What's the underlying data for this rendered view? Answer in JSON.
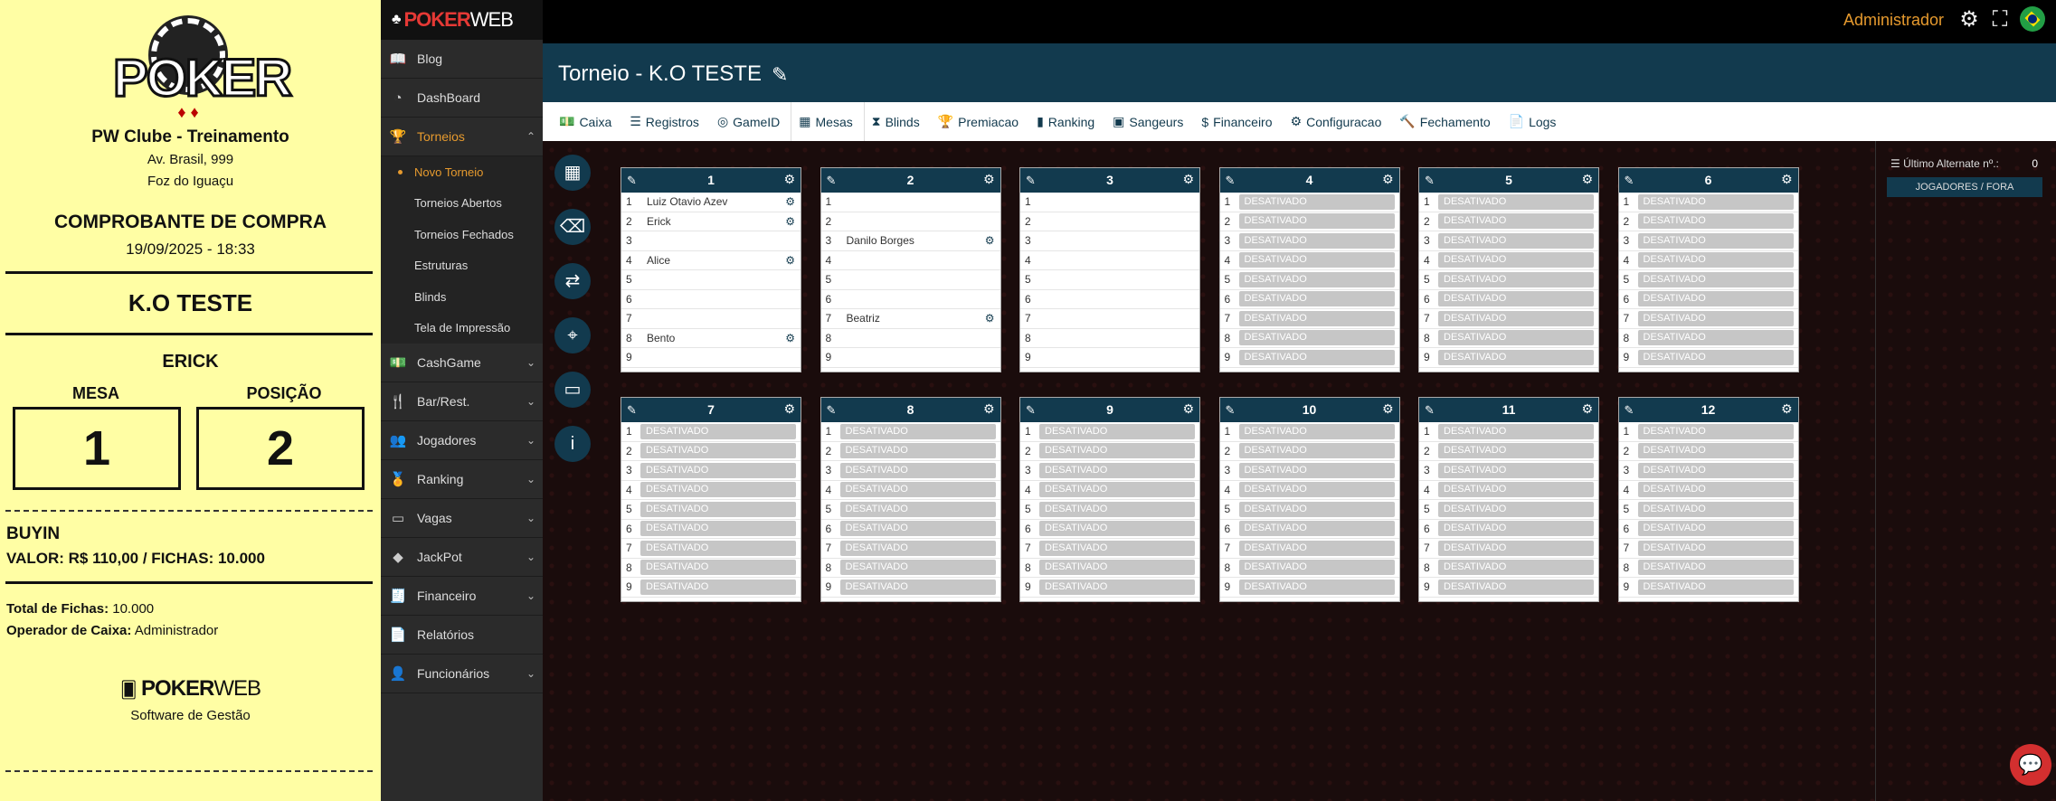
{
  "receipt": {
    "logo_text": "POKER",
    "club": "PW Clube - Treinamento",
    "address": "Av. Brasil, 999",
    "city": "Foz do Iguaçu",
    "title": "COMPROBANTE DE COMPRA",
    "datetime": "19/09/2025 - 18:33",
    "tournament": "K.O TESTE",
    "player": "ERICK",
    "mesa_label": "MESA",
    "posicao_label": "POSIÇÃO",
    "mesa": "1",
    "posicao": "2",
    "buyin_label": "BUYIN",
    "valor_line": "VALOR: R$ 110,00 / FICHAS: 10.000",
    "total_label": "Total de Fichas:",
    "total_value": " 10.000",
    "operador_label": "Operador de Caixa:",
    "operador_value": " Administrador",
    "footer_brand_a": "POKER",
    "footer_brand_b": "WEB",
    "footer_sub": "Software de Gestão"
  },
  "sidebar": {
    "brand_a": "POKER",
    "brand_b": "WEB",
    "items": [
      {
        "label": "Blog",
        "icon": "book-icon",
        "glyph": "📖"
      },
      {
        "label": "DashBoard",
        "icon": "chart-pie-icon",
        "glyph": "◔"
      },
      {
        "label": "Torneios",
        "icon": "trophy-icon",
        "glyph": "🏆"
      }
    ],
    "subitems": [
      "Novo Torneio",
      "Torneios Abertos",
      "Torneios Fechados",
      "Estruturas",
      "Blinds",
      "Tela de Impressão"
    ],
    "items2": [
      {
        "label": "CashGame",
        "icon": "money-icon",
        "glyph": "💵"
      },
      {
        "label": "Bar/Rest.",
        "icon": "utensils-icon",
        "glyph": "🍴"
      },
      {
        "label": "Jogadores",
        "icon": "users-icon",
        "glyph": "👥"
      },
      {
        "label": "Ranking",
        "icon": "medal-icon",
        "glyph": "🏅"
      },
      {
        "label": "Vagas",
        "icon": "chair-icon",
        "glyph": "▭"
      },
      {
        "label": "JackPot",
        "icon": "gem-icon",
        "glyph": "◆"
      },
      {
        "label": "Financeiro",
        "icon": "invoice-icon",
        "glyph": "🧾"
      },
      {
        "label": "Relatórios",
        "icon": "report-icon",
        "glyph": "📄"
      },
      {
        "label": "Funcionários",
        "icon": "user-tie-icon",
        "glyph": "👤"
      }
    ]
  },
  "topbar": {
    "admin": "Administrador"
  },
  "page": {
    "title": "Torneio -  K.O TESTE"
  },
  "tabs": [
    {
      "label": "Caixa",
      "glyph": "💵"
    },
    {
      "label": "Registros",
      "glyph": "☰"
    },
    {
      "label": "GameID",
      "glyph": "◎"
    },
    {
      "label": "Mesas",
      "glyph": "▦"
    },
    {
      "label": "Blinds",
      "glyph": "⧗"
    },
    {
      "label": "Premiacao",
      "glyph": "🏆"
    },
    {
      "label": "Ranking",
      "glyph": "▮"
    },
    {
      "label": "Sangeurs",
      "glyph": "▣"
    },
    {
      "label": "Financeiro",
      "glyph": "$"
    },
    {
      "label": "Configuracao",
      "glyph": "⚙"
    },
    {
      "label": "Fechamento",
      "glyph": "🔨"
    },
    {
      "label": "Logs",
      "glyph": "📄"
    }
  ],
  "right_panel": {
    "alt_label": "Último Alternate nº.:",
    "alt_value": "0",
    "button": "JOGADORES / FORA"
  },
  "disabled_label": "DESATIVADO",
  "tables": [
    {
      "number": "1",
      "seats": [
        "Luiz Otavio Azev",
        "Erick",
        "",
        "Alice",
        "",
        "",
        "",
        "Bento",
        ""
      ]
    },
    {
      "number": "2",
      "seats": [
        "",
        "",
        "Danilo Borges",
        "",
        "",
        "",
        "Beatriz",
        "",
        ""
      ]
    },
    {
      "number": "3",
      "seats": [
        "",
        "",
        "",
        "",
        "",
        "",
        "",
        "",
        ""
      ]
    },
    {
      "number": "4",
      "disabled": true
    },
    {
      "number": "5",
      "disabled": true
    },
    {
      "number": "6",
      "disabled": true
    },
    {
      "number": "7",
      "disabled": true
    },
    {
      "number": "8",
      "disabled": true
    },
    {
      "number": "9",
      "disabled": true
    },
    {
      "number": "10",
      "disabled": true
    },
    {
      "number": "11",
      "disabled": true
    },
    {
      "number": "12",
      "disabled": true
    }
  ]
}
